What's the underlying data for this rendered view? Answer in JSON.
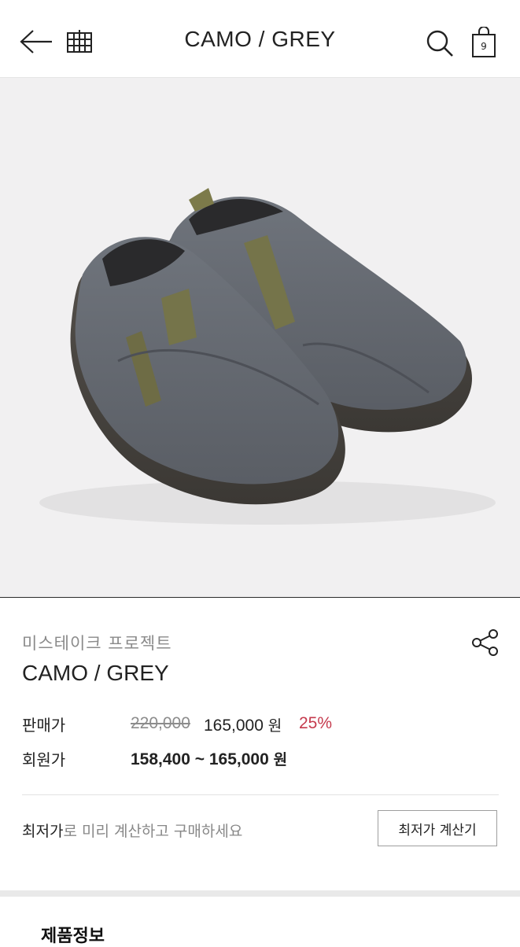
{
  "header": {
    "title": "CAMO / GREY",
    "cart_count": "9"
  },
  "product": {
    "brand": "미스테이크 프로젝트",
    "name": "CAMO / GREY",
    "sale_label": "판매가",
    "original_price": "220,000",
    "sale_price": "165,000",
    "currency": "원",
    "discount": "25%",
    "member_label": "회원가",
    "member_price": "158,400 ~ 165,000"
  },
  "calc": {
    "text_strong": "최저가",
    "text_rest": "로 미리 계산하고 구매하세요",
    "button_label": "최저가 계산기"
  },
  "section": {
    "title": "제품정보"
  },
  "icons": [
    "back-arrow-icon",
    "brand-logo-icon",
    "search-icon",
    "shopping-bag-icon",
    "share-icon"
  ],
  "colors": {
    "discount": "#c53a4d",
    "hero_background": "#f1f0f1"
  }
}
